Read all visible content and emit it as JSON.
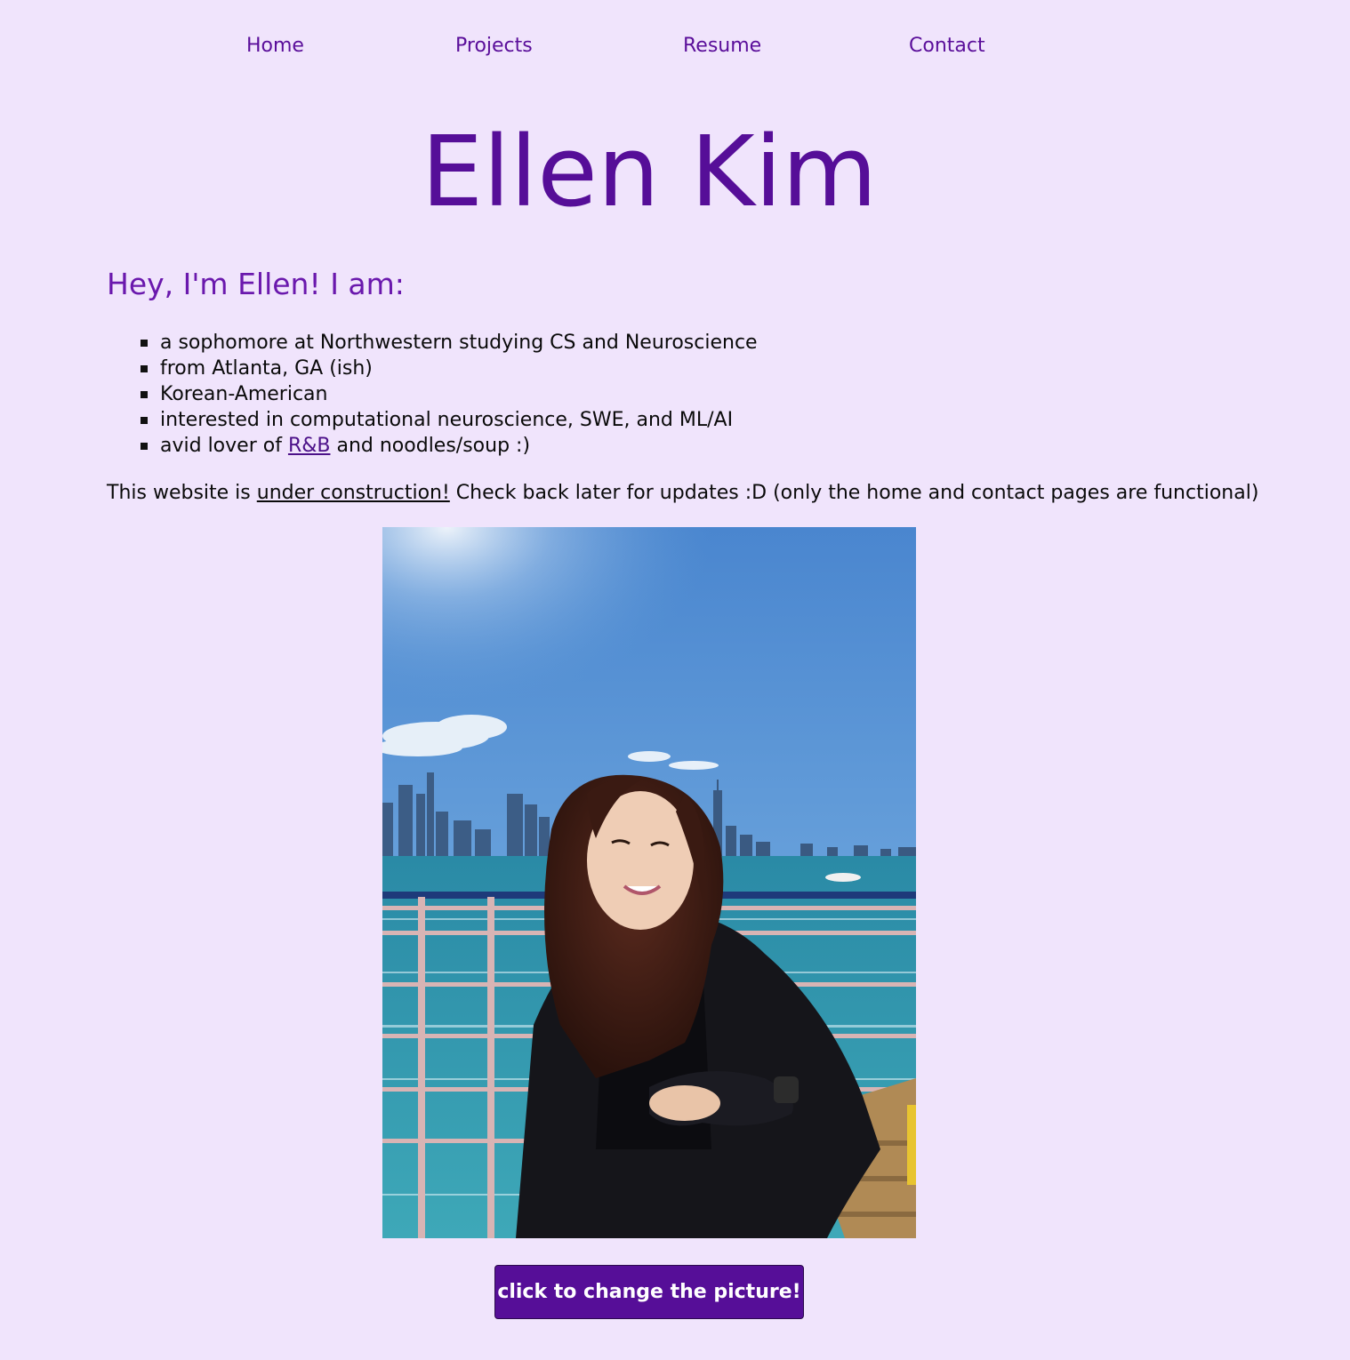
{
  "nav": {
    "home": "Home",
    "projects": "Projects",
    "resume": "Resume",
    "contact": "Contact"
  },
  "title": "Ellen Kim",
  "intro": "Hey, I'm Ellen! I am:",
  "facts": {
    "item1": "a sophomore at Northwestern studying CS and Neuroscience",
    "item2": "from Atlanta, GA (ish)",
    "item3": "Korean-American",
    "item4": "interested in computational neuroscience, SWE, and ML/AI",
    "item5_before": "avid lover of ",
    "item5_link": "R&B",
    "item5_after": " and noodles/soup :)"
  },
  "notice": {
    "before": "This website is ",
    "link": "under construction!",
    "after": " Check back later for updates :D (only the home and contact pages are functional)"
  },
  "button": {
    "label": "click to change the picture!"
  },
  "colors": {
    "background": "#f0e4fc",
    "accent": "#560e98",
    "heading": "#6a18ad"
  }
}
